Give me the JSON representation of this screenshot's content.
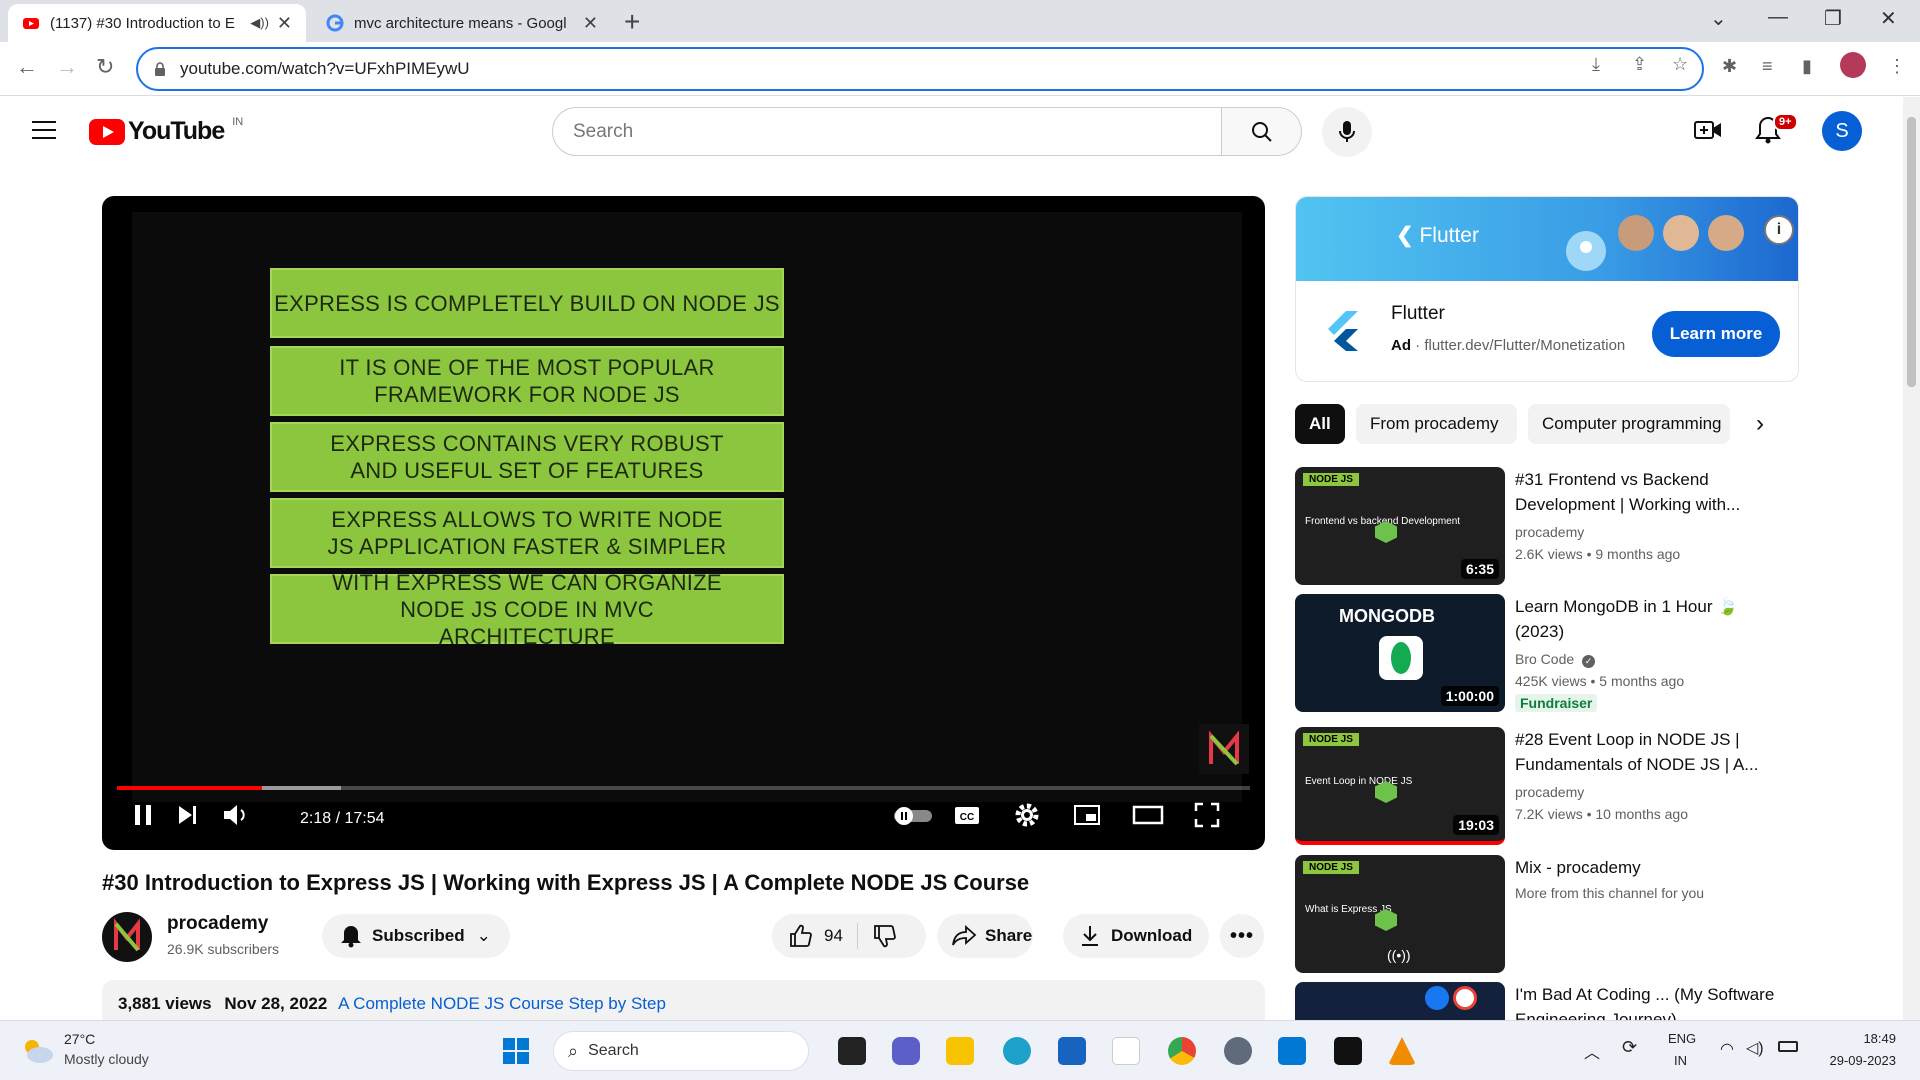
{
  "browser": {
    "tabs": [
      {
        "title": "(1137) #30 Introduction to E",
        "active": true
      },
      {
        "title": "mvc architecture means - Googl",
        "active": false
      }
    ],
    "url": "youtube.com/watch?v=UFxhPIMEywU"
  },
  "youtube": {
    "logo_text": "YouTube",
    "country_code": "IN",
    "search_placeholder": "Search",
    "notification_badge": "9+",
    "avatar_letter": "S"
  },
  "player": {
    "slide_lines": [
      "EXPRESS IS COMPLETELY BUILD ON NODE JS",
      "IT IS ONE OF THE MOST POPULAR FRAMEWORK FOR NODE JS",
      "EXPRESS CONTAINS VERY ROBUST AND USEFUL SET OF FEATURES",
      "EXPRESS ALLOWS TO WRITE NODE JS APPLICATION FASTER & SIMPLER",
      "WITH EXPRESS WE CAN ORGANIZE NODE JS CODE IN MVC ARCHITECTURE"
    ],
    "time": "2:18 / 17:54",
    "progress_fraction": 0.128,
    "buffer_fraction": 0.198
  },
  "video": {
    "title": "#30 Introduction to Express JS | Working with Express JS | A Complete NODE JS Course",
    "channel_name": "procademy",
    "subscribers": "26.9K subscribers",
    "subscribe_label": "Subscribed",
    "likes": "94",
    "share_label": "Share",
    "download_label": "Download",
    "views": "3,881 views",
    "date": "Nov 28, 2022",
    "playlist": "A Complete NODE JS Course Step by Step"
  },
  "ad": {
    "banner_brand": "Flutter",
    "name": "Flutter",
    "ad_label": "Ad",
    "link": "flutter.dev/Flutter/Monetization",
    "cta": "Learn more"
  },
  "chips": [
    "All",
    "From procademy",
    "Computer programming"
  ],
  "recommendations": [
    {
      "title": "#31 Frontend vs Backend Development | Working with...",
      "channel": "procademy",
      "meta": "2.6K views  •  9 months ago",
      "duration": "6:35",
      "thumb_text": "Frontend vs backend Development"
    },
    {
      "title": "Learn MongoDB in 1 Hour 🍃 (2023)",
      "channel": "Bro Code",
      "meta": "425K views  •  5 months ago",
      "duration": "1:00:00",
      "badge": "Fundraiser",
      "thumb_text": "MONGODB"
    },
    {
      "title": "#28 Event Loop in NODE JS | Fundamentals of NODE JS | A...",
      "channel": "procademy",
      "meta": "7.2K views  •  10 months ago",
      "duration": "19:03",
      "thumb_text": "Event Loop in NODE JS"
    },
    {
      "title": "Mix - procademy",
      "channel": "More from this channel for you",
      "meta": "",
      "duration": "",
      "thumb_text": "What is Express JS"
    },
    {
      "title": "I'm Bad At Coding ... (My Software Engineering Journey)",
      "channel": "",
      "meta": "",
      "duration": "",
      "thumb_text": ""
    }
  ],
  "taskbar": {
    "temperature": "27°C",
    "weather": "Mostly cloudy",
    "search": "Search",
    "lang1": "ENG",
    "lang2": "IN",
    "time": "18:49",
    "date": "29-09-2023"
  },
  "colors": {
    "yt_red": "#ff0000",
    "link_blue": "#065fd4",
    "slide_green": "#8cc63f"
  }
}
